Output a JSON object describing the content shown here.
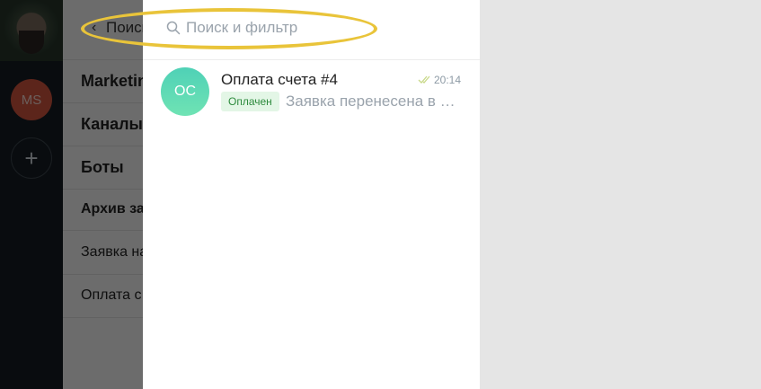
{
  "rail": {
    "workspace_initials": "MS",
    "add_symbol": "+"
  },
  "background_list": {
    "search_label": "Поиск",
    "rows": [
      "Marketing",
      "Каналы",
      "Боты",
      "Архив за",
      "Заявка на",
      "Оплата с"
    ]
  },
  "search": {
    "placeholder": "Поиск и фильтр"
  },
  "chat": {
    "avatar_initials": "OC",
    "title": "Оплата счета #4",
    "time": "20:14",
    "tag": "Оплачен",
    "preview": "Заявка перенесена в …"
  },
  "colors": {
    "accent_highlight": "#e9c43a",
    "avatar_gradient_top": "#4fd1b6",
    "tag_bg": "#e3f6e6",
    "tag_text": "#2e8b3e"
  }
}
